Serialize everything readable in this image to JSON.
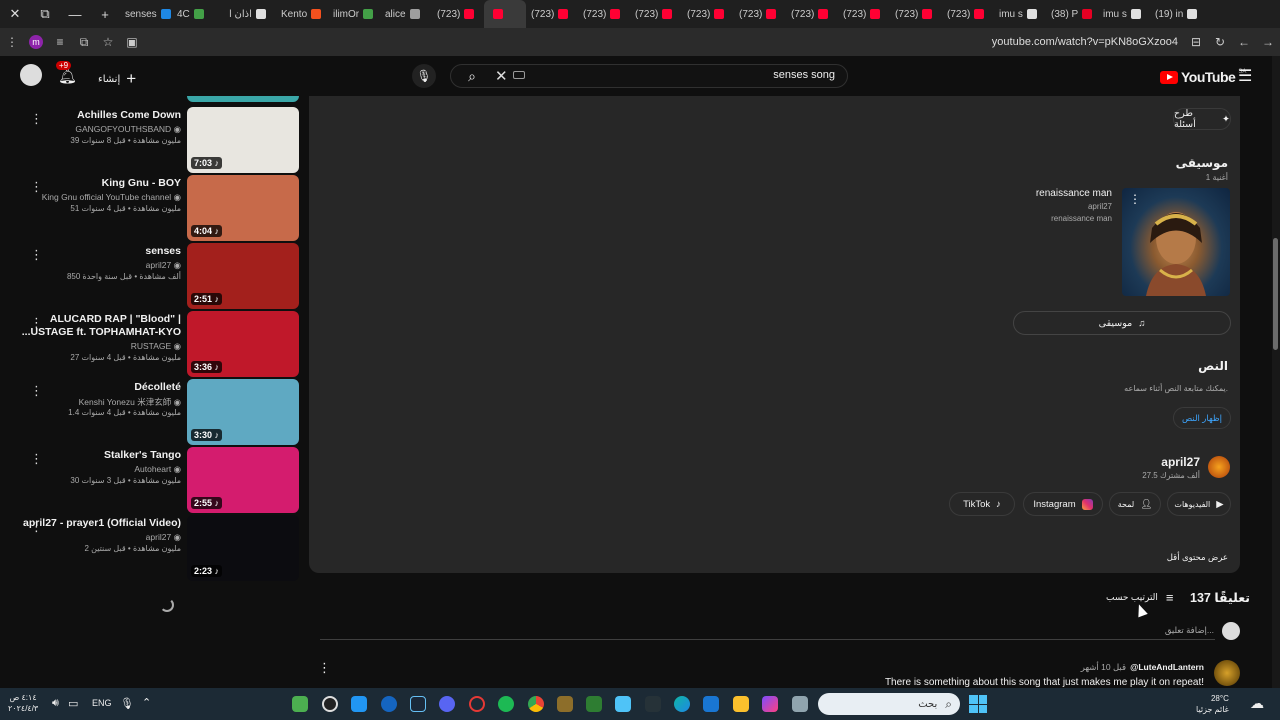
{
  "tabs": [
    {
      "label": "senses",
      "color": "#1e88e5"
    },
    {
      "label": "4C",
      "color": "#43a047"
    },
    {
      "label": "اذان ا",
      "color": "#e0e0e0"
    },
    {
      "label": "Kento",
      "color": "#f4511e"
    },
    {
      "label": "ilimOr",
      "color": "#43a047"
    },
    {
      "label": "alice",
      "color": "#9e9e9e"
    },
    {
      "label": "(723)",
      "color": "#ff0033"
    },
    {
      "label": "",
      "color": "#ff0033",
      "active": true
    },
    {
      "label": "(723)",
      "color": "#ff0033"
    },
    {
      "label": "(723)",
      "color": "#ff0033"
    },
    {
      "label": "(723)",
      "color": "#ff0033"
    },
    {
      "label": "(723)",
      "color": "#ff0033"
    },
    {
      "label": "(723)",
      "color": "#ff0033"
    },
    {
      "label": "(723)",
      "color": "#ff0033"
    },
    {
      "label": "(723)",
      "color": "#ff0033"
    },
    {
      "label": "(723)",
      "color": "#ff0033"
    },
    {
      "label": "(723)",
      "color": "#ff0033"
    },
    {
      "label": "imu s",
      "color": "#e0e0e0"
    },
    {
      "label": "(38) P",
      "color": "#e60023"
    },
    {
      "label": "imu s",
      "color": "#e0e0e0"
    },
    {
      "label": "(19) in",
      "color": "#e0e0e0"
    }
  ],
  "address": {
    "url": "youtube.com/watch?v=pKN8oGXzoo4"
  },
  "header": {
    "logo": "YouTube",
    "logo_region": "SA",
    "search_query": "senses song",
    "create_label": "إنشاء",
    "notifications_badge": "+9"
  },
  "sidebar_videos": [
    {
      "title": "Achilles Come Down",
      "channel": "GANGOFYOUTHSBAND",
      "meta": "39 مليون مشاهدة • قبل 8 سنوات",
      "duration": "7:03",
      "thumb": "#e8e6e0"
    },
    {
      "title": "King Gnu - BOY",
      "channel": "King Gnu official YouTube channel",
      "meta": "51 مليون مشاهدة • قبل 4 سنوات",
      "duration": "4:04",
      "thumb": "#c76a4a"
    },
    {
      "title": "senses",
      "channel": "april27",
      "meta": "850 ألف مشاهدة • قبل سنة واحدة",
      "duration": "2:51",
      "thumb": "#a3201c"
    },
    {
      "title": "ALUCARD RAP | \"Blood\" |",
      "title2": "...USTAGE ft. TOPHAMHAT-KYO",
      "channel": "RUSTAGE",
      "meta": "27 مليون مشاهدة • قبل 4 سنوات",
      "duration": "3:36",
      "thumb": "#c0182a"
    },
    {
      "title": "Décolleté",
      "channel": "Kenshi Yonezu 米津玄師",
      "meta": "1.4 مليون مشاهدة • قبل 4 سنوات",
      "duration": "3:30",
      "thumb": "#5fa9c2"
    },
    {
      "title": "Stalker's Tango",
      "channel": "Autoheart",
      "meta": "30 مليون مشاهدة • قبل 3 سنوات",
      "duration": "2:55",
      "thumb": "#d41c6e"
    },
    {
      "title": "april27 - prayer1 (Official Video)",
      "channel": "april27",
      "meta": "2 مليون مشاهدة • قبل سنتين",
      "duration": "2:23",
      "thumb": "#0c0c10"
    }
  ],
  "description": {
    "ask_button": "طرح أسئلة",
    "music_heading": "موسيقى",
    "music_count": "1 أغنية",
    "song_title": "renaissance man",
    "song_artist": "april27",
    "song_album": "renaissance man",
    "music_button": "موسيقى",
    "transcript_heading": "النص",
    "transcript_sub": "يمكنك متابعة النص أثناء سماعه.",
    "transcript_button": "إظهار النص",
    "channel_name": "april27",
    "channel_subs": "27.5 ألف مشترك",
    "links": {
      "videos": "الفيديوهات",
      "about": "لمحة",
      "instagram": "Instagram",
      "tiktok": "TikTok"
    },
    "show_less": "عرض محتوى أقل"
  },
  "comments": {
    "count_label": "137 تعليقًا",
    "sort_label": "الترتيب حسب",
    "add_placeholder": "إضافة تعليق...",
    "first_author": "@LuteAndLantern",
    "first_age": "قبل 10 أشهر",
    "first_text": "There is something about this song that just makes me play it on repeat!"
  },
  "taskbar": {
    "time": "٤:١٤ ص",
    "date": "٢٠٢٤/٤/٣",
    "lang": "ENG",
    "search": "بحث",
    "weather_temp": "28°C",
    "weather_desc": "غائم جزئيا"
  }
}
